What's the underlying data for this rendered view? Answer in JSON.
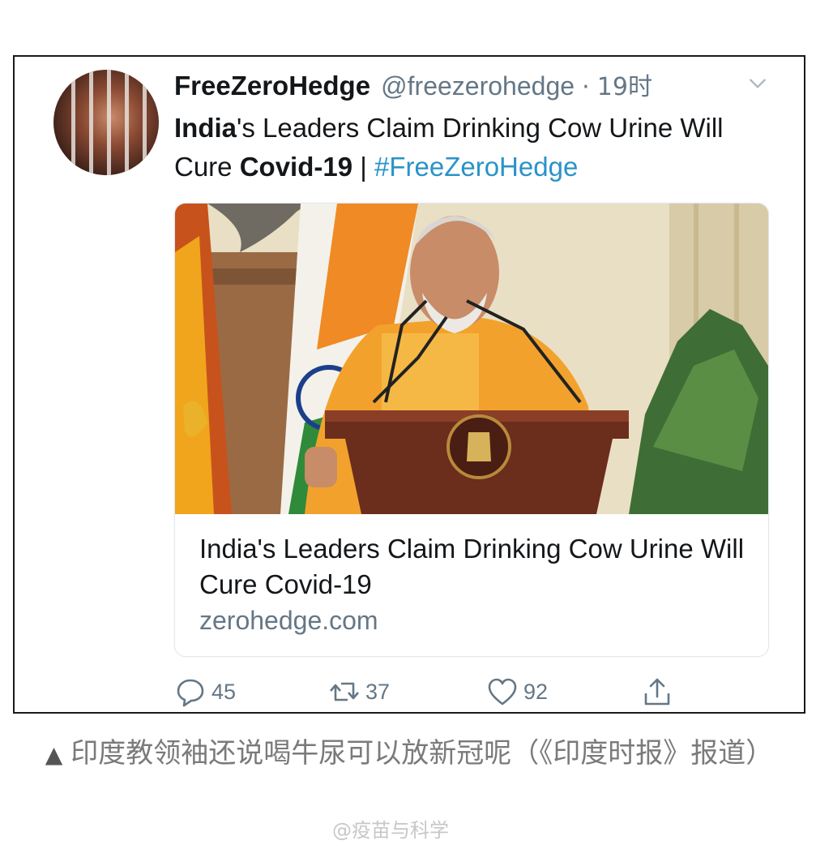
{
  "tweet": {
    "display_name": "FreeZeroHedge",
    "handle": "@freezerohedge",
    "separator": "·",
    "time": "19时",
    "text_part1_bold": "India",
    "text_part2": "'s Leaders Claim Drinking Cow Urine Will Cure ",
    "text_part3_bold": "Covid-19",
    "text_part4": " | ",
    "hashtag": "#FreeZeroHedge"
  },
  "card": {
    "title": "India's Leaders Claim Drinking Cow Urine Will Cure Covid-19",
    "domain": "zerohedge.com"
  },
  "actions": {
    "reply_count": "45",
    "retweet_count": "37",
    "like_count": "92"
  },
  "caption": {
    "marker": "▲",
    "text": "印度教领袖还说喝牛尿可以放新冠呢（《印度时报》报道）"
  },
  "watermark": "@疫苗与科学",
  "colors": {
    "hashtag": "#2a93c8",
    "secondary_text": "#657786",
    "caption_text": "#7a7a7a"
  }
}
